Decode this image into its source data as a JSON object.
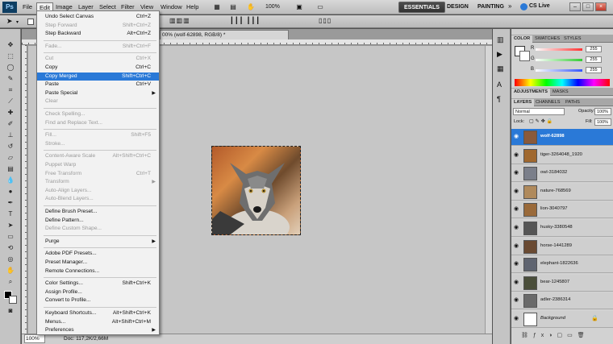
{
  "app": {
    "logo": "Ps"
  },
  "menubar": {
    "items": [
      "File",
      "Edit",
      "Image",
      "Layer",
      "Select",
      "Filter",
      "View",
      "Window",
      "Help"
    ],
    "zoom": "100%",
    "workspaces": [
      "ESSENTIALS",
      "DESIGN",
      "PAINTING"
    ],
    "more": "»",
    "cslive": "CS Live",
    "window_buttons": [
      "–",
      "□",
      "×"
    ]
  },
  "document": {
    "tab_title": "00% (wolf-62898, RGB/8) *",
    "zoom_status": "100%",
    "doc_status": "Doc: 117,2K/2,66M"
  },
  "edit_menu": [
    {
      "label": "Undo Select Canvas",
      "shortcut": "Ctrl+Z",
      "disabled": false
    },
    {
      "label": "Step Forward",
      "shortcut": "Shift+Ctrl+Z",
      "disabled": true
    },
    {
      "label": "Step Backward",
      "shortcut": "Alt+Ctrl+Z",
      "disabled": false
    },
    {
      "sep": true
    },
    {
      "label": "Fade...",
      "shortcut": "Shift+Ctrl+F",
      "disabled": true
    },
    {
      "sep": true
    },
    {
      "label": "Cut",
      "shortcut": "Ctrl+X",
      "disabled": true
    },
    {
      "label": "Copy",
      "shortcut": "Ctrl+C",
      "disabled": false
    },
    {
      "label": "Copy Merged",
      "shortcut": "Shift+Ctrl+C",
      "disabled": false,
      "highlight": true
    },
    {
      "label": "Paste",
      "shortcut": "Ctrl+V",
      "disabled": false
    },
    {
      "label": "Paste Special",
      "shortcut": "",
      "submenu": true,
      "disabled": false
    },
    {
      "label": "Clear",
      "shortcut": "",
      "disabled": true
    },
    {
      "sep": true
    },
    {
      "label": "Check Spelling...",
      "shortcut": "",
      "disabled": true
    },
    {
      "label": "Find and Replace Text...",
      "shortcut": "",
      "disabled": true
    },
    {
      "sep": true
    },
    {
      "label": "Fill...",
      "shortcut": "Shift+F5",
      "disabled": true
    },
    {
      "label": "Stroke...",
      "shortcut": "",
      "disabled": true
    },
    {
      "sep": true
    },
    {
      "label": "Content-Aware Scale",
      "shortcut": "Alt+Shift+Ctrl+C",
      "disabled": true
    },
    {
      "label": "Puppet Warp",
      "shortcut": "",
      "disabled": true
    },
    {
      "label": "Free Transform",
      "shortcut": "Ctrl+T",
      "disabled": true
    },
    {
      "label": "Transform",
      "shortcut": "",
      "submenu": true,
      "disabled": true
    },
    {
      "label": "Auto-Align Layers...",
      "shortcut": "",
      "disabled": true
    },
    {
      "label": "Auto-Blend Layers...",
      "shortcut": "",
      "disabled": true
    },
    {
      "sep": true
    },
    {
      "label": "Define Brush Preset...",
      "shortcut": "",
      "disabled": false
    },
    {
      "label": "Define Pattern...",
      "shortcut": "",
      "disabled": false
    },
    {
      "label": "Define Custom Shape...",
      "shortcut": "",
      "disabled": true
    },
    {
      "sep": true
    },
    {
      "label": "Purge",
      "shortcut": "",
      "submenu": true,
      "disabled": false
    },
    {
      "sep": true
    },
    {
      "label": "Adobe PDF Presets...",
      "shortcut": "",
      "disabled": false
    },
    {
      "label": "Preset Manager...",
      "shortcut": "",
      "disabled": false
    },
    {
      "label": "Remote Connections...",
      "shortcut": "",
      "disabled": false
    },
    {
      "sep": true
    },
    {
      "label": "Color Settings...",
      "shortcut": "Shift+Ctrl+K",
      "disabled": false
    },
    {
      "label": "Assign Profile...",
      "shortcut": "",
      "disabled": false
    },
    {
      "label": "Convert to Profile...",
      "shortcut": "",
      "disabled": false
    },
    {
      "sep": true
    },
    {
      "label": "Keyboard Shortcuts...",
      "shortcut": "Alt+Shift+Ctrl+K",
      "disabled": false
    },
    {
      "label": "Menus...",
      "shortcut": "Alt+Shift+Ctrl+M",
      "disabled": false
    },
    {
      "label": "Preferences",
      "shortcut": "",
      "submenu": true,
      "disabled": false
    }
  ],
  "color_panel": {
    "tabs": [
      "COLOR",
      "SWATCHES",
      "STYLES"
    ],
    "channels": [
      {
        "label": "R",
        "value": "255",
        "color": "#ff3333"
      },
      {
        "label": "G",
        "value": "255",
        "color": "#33cc33"
      },
      {
        "label": "B",
        "value": "255",
        "color": "#3355ff"
      }
    ]
  },
  "adjustments_panel": {
    "tabs": [
      "ADJUSTMENTS",
      "MASKS"
    ]
  },
  "layers_panel": {
    "tabs": [
      "LAYERS",
      "CHANNELS",
      "PATHS"
    ],
    "blend_mode": "Normal",
    "opacity_label": "Opacity:",
    "opacity": "100%",
    "lock_label": "Lock:",
    "fill_label": "Fill:",
    "fill": "100%",
    "layers": [
      {
        "name": "wolf-62898",
        "selected": true,
        "color": "#8a5a3a"
      },
      {
        "name": "tiger-3264048_1920",
        "selected": false,
        "color": "#a0682e"
      },
      {
        "name": "owl-3184032",
        "selected": false,
        "color": "#7b7f8a"
      },
      {
        "name": "nature-768569",
        "selected": false,
        "color": "#b08a5c"
      },
      {
        "name": "lion-3040797",
        "selected": false,
        "color": "#9a6a3a"
      },
      {
        "name": "husky-3380548",
        "selected": false,
        "color": "#555"
      },
      {
        "name": "horse-1441289",
        "selected": false,
        "color": "#6a4a32"
      },
      {
        "name": "elephant-1822636",
        "selected": false,
        "color": "#5f6470"
      },
      {
        "name": "bear-1245807",
        "selected": false,
        "color": "#4a4e3a"
      },
      {
        "name": "adler-2386314",
        "selected": false,
        "color": "#6a6a6a"
      },
      {
        "name": "Background",
        "selected": false,
        "color": "#ffffff",
        "italic": true
      }
    ]
  }
}
